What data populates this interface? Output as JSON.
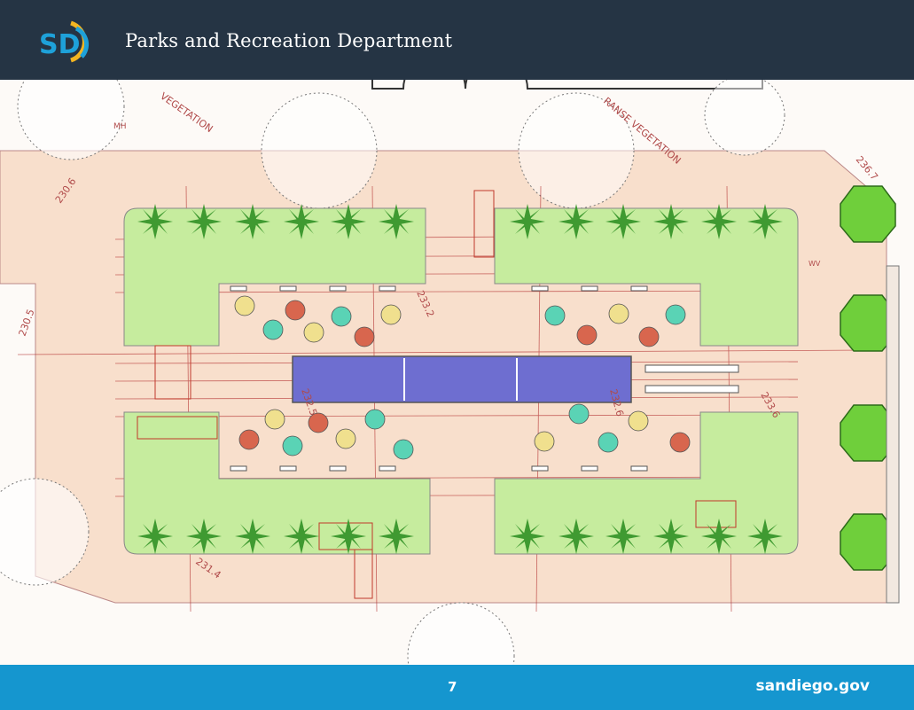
{
  "header": {
    "logo_text": "SD",
    "title": "Parks and Recreation Department"
  },
  "plan": {
    "labels": {
      "vegetation_left": "VEGETATION",
      "vegetation_right": "RANSE VEGETATION",
      "elev_1": "230.6",
      "elev_2": "230.5",
      "elev_3": "233.2",
      "elev_4": "232.5",
      "elev_5": "232.6",
      "elev_6": "233.6",
      "elev_7": "231.4",
      "elev_8": "236.7",
      "mh": "MH",
      "wv": "WV"
    }
  },
  "footer": {
    "page_number": "7",
    "website": "sandiego.gov"
  },
  "colors": {
    "header_bg": "#253444",
    "footer_bg": "#1596cf",
    "plaza": "#f8dfcc",
    "lawn": "#c6ec9e",
    "pool": "#6e6ed0",
    "survey_lines": "#b22d2d",
    "tree": "#6fcf3b"
  }
}
